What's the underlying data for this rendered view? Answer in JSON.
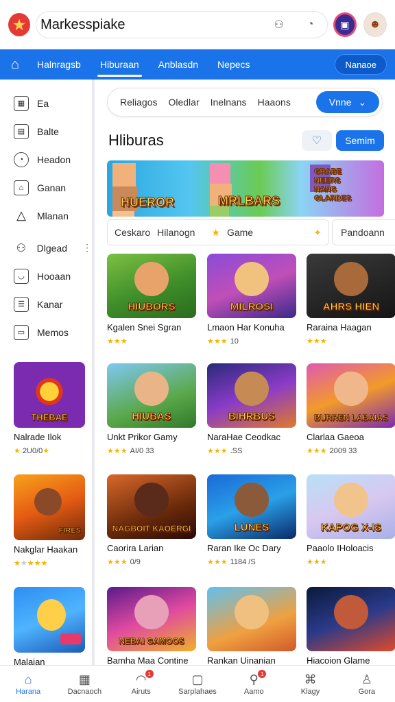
{
  "app": {
    "title": "Markesspiake",
    "logo_icon": "star-logo-icon"
  },
  "header": {
    "icons": [
      "gamepad-icon",
      "timer-icon"
    ],
    "profile_button_icon": "id-card-icon",
    "avatar_icon": "avatar-icon"
  },
  "nav": {
    "tabs": [
      {
        "label": "Halnragsb",
        "active": false
      },
      {
        "label": "Hiburaan",
        "active": true
      },
      {
        "label": "Anblasdn",
        "active": false
      },
      {
        "label": "Nepecs",
        "active": false
      }
    ],
    "button_label": "Nanaoe"
  },
  "sidebar": {
    "items": [
      {
        "label": "Ea",
        "icon": "grid-icon"
      },
      {
        "label": "Balte",
        "icon": "calendar-icon"
      },
      {
        "label": "Headon",
        "icon": "gauge-icon"
      },
      {
        "label": "Ganan",
        "icon": "box-icon"
      },
      {
        "label": "Mlanan",
        "icon": "bell-icon"
      },
      {
        "label": "Dlgead",
        "icon": "controller-icon"
      },
      {
        "label": "Hooaan",
        "icon": "chat-icon"
      },
      {
        "label": "Kanar",
        "icon": "list-icon"
      },
      {
        "label": "Memos",
        "icon": "note-icon"
      }
    ],
    "games": [
      {
        "title": "Nalrade Ilok",
        "rating": "2U0/0"
      },
      {
        "title": "Nakglar Haakan",
        "rating": ""
      },
      {
        "title": "Malaian",
        "rating": ""
      }
    ]
  },
  "main": {
    "filters": [
      "Reliagos",
      "Oledlar",
      "Inelnans",
      "Haaons"
    ],
    "filter_button": "Vnne",
    "section_title": "Hliburas",
    "save_button": "Semim",
    "banner": {
      "texts": [
        "HUEROR",
        "MRLBARS",
        "GRABE NEERS NANG GLARDES"
      ]
    },
    "chips": [
      "Ceskaro",
      "Hilanogn",
      "Game"
    ],
    "chip_right": "Pandoann",
    "games": [
      {
        "title": "Kgalen Snei Sgran",
        "rating": "",
        "art": "HIUBORS"
      },
      {
        "title": "Lmaon Har Konuha",
        "rating": "10",
        "art": "MILROSI"
      },
      {
        "title": "Raraina Haagan",
        "rating": "",
        "art": "AHRS HIEN"
      },
      {
        "title": "Unkt Prikor Gamy",
        "rating": "AI/0 33",
        "art": "HIUBAS"
      },
      {
        "title": "NaraHae Ceodkac",
        "rating": ".SS",
        "art": "BIHRBUS"
      },
      {
        "title": "Clarlaa Gaeoa",
        "rating": "2009 33",
        "art": "BURREN LABAIAS"
      },
      {
        "title": "Caorira Larian",
        "rating": "0/9",
        "art": "NAGBOIT KAOERGI"
      },
      {
        "title": "Raran Ike Oc Dary",
        "rating": "1184 /S",
        "art": "LUNES"
      },
      {
        "title": "Paaolo IHoloacis",
        "rating": "",
        "art": "KAPOG X-IS"
      },
      {
        "title": "Bamha Maa Contine",
        "rating": "",
        "art": "NEBAI GAMOOS"
      },
      {
        "title": "Rankan Uinanian",
        "rating": "",
        "art": ""
      },
      {
        "title": "Hiacoion Glame",
        "rating": "",
        "art": ""
      }
    ]
  },
  "bottom_nav": [
    {
      "label": "Harana",
      "icon": "home-icon",
      "active": true
    },
    {
      "label": "Dacnaoch",
      "icon": "calendar-icon",
      "active": false
    },
    {
      "label": "Airuts",
      "icon": "person-icon",
      "active": false,
      "badge": "1"
    },
    {
      "label": "Sarplahaes",
      "icon": "gift-icon",
      "active": false
    },
    {
      "label": "Aamo",
      "icon": "search-icon",
      "active": false,
      "badge": "1"
    },
    {
      "label": "Klagy",
      "icon": "tag-icon",
      "active": false
    },
    {
      "label": "Gora",
      "icon": "profile-icon",
      "active": false
    }
  ]
}
